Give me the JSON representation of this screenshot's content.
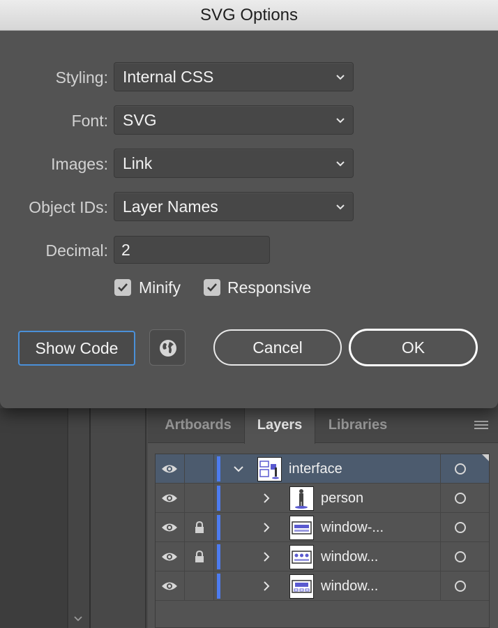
{
  "dialog": {
    "title": "SVG Options",
    "fields": {
      "styling": {
        "label": "Styling:",
        "value": "Internal CSS"
      },
      "font": {
        "label": "Font:",
        "value": "SVG"
      },
      "images": {
        "label": "Images:",
        "value": "Link"
      },
      "object_ids": {
        "label": "Object IDs:",
        "value": "Layer Names"
      },
      "decimal": {
        "label": "Decimal:",
        "value": "2"
      }
    },
    "checkboxes": {
      "minify": {
        "label": "Minify",
        "checked": true
      },
      "responsive": {
        "label": "Responsive",
        "checked": true
      }
    },
    "buttons": {
      "show_code": "Show Code",
      "cancel": "Cancel",
      "ok": "OK"
    }
  },
  "panel": {
    "tabs": [
      "Artboards",
      "Layers",
      "Libraries"
    ],
    "active_tab": "Layers",
    "layers": [
      {
        "name": "interface",
        "expanded": true,
        "locked": false,
        "visible": true,
        "selected": true
      },
      {
        "name": "person",
        "expanded": false,
        "locked": false,
        "visible": true,
        "selected": false
      },
      {
        "name": "window-...",
        "expanded": false,
        "locked": true,
        "visible": true,
        "selected": false
      },
      {
        "name": "window...",
        "expanded": false,
        "locked": true,
        "visible": true,
        "selected": false
      },
      {
        "name": "window...",
        "expanded": false,
        "locked": false,
        "visible": true,
        "selected": false
      }
    ],
    "layer_color": "#4d7cf0"
  },
  "colors": {
    "dialog_bg": "#535353",
    "focus_ring": "#4a90d9",
    "selected_row": "#4c5b6e"
  }
}
